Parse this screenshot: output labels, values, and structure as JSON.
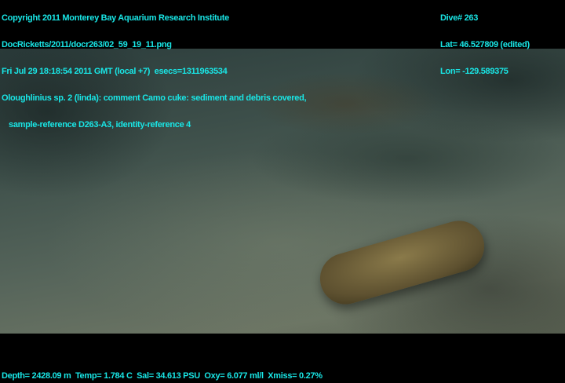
{
  "header_left": {
    "copyright": "Copyright 2011 Monterey Bay Aquarium Research Institute",
    "file": "DocRicketts/2011/docr263/02_59_19_11.png",
    "timestamp": "Fri Jul 29 18:18:54 2011 GMT (local +7)  esecs=1311963534",
    "annotation": "Oloughlinius sp. 2 (linda): comment Camo cuke: sediment and debris covered,",
    "annotation_cont": "sample-reference D263-A3, identity-reference 4"
  },
  "header_right": {
    "dive": "Dive# 263",
    "lat": "Lat= 46.527809 (edited)",
    "lon": "Lon= -129.589375"
  },
  "footer": {
    "sensors": "Depth= 2428.09 m  Temp= 1.784 C  Sal= 34.613 PSU  Oxy= 6.077 ml/l  Xmiss= 0.27%"
  },
  "colors": {
    "overlay_text": "#19e6e6"
  }
}
